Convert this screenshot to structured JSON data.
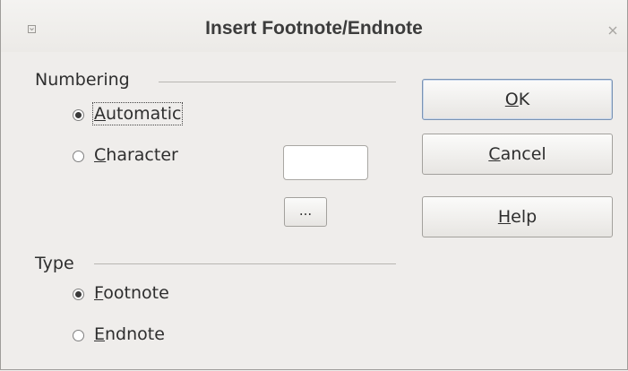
{
  "window": {
    "title": "Insert Footnote/Endnote"
  },
  "numbering": {
    "label": "Numbering",
    "automatic": {
      "accel": "A",
      "rest": "utomatic",
      "checked": true
    },
    "character": {
      "accel": "C",
      "rest": "haracter",
      "checked": false
    },
    "character_value": "",
    "browse_label": "..."
  },
  "type": {
    "label": "Type",
    "footnote": {
      "accel": "F",
      "rest": "ootnote",
      "checked": true
    },
    "endnote": {
      "accel": "E",
      "rest": "ndnote",
      "checked": false
    }
  },
  "buttons": {
    "ok": {
      "accel": "O",
      "rest": "K"
    },
    "cancel": {
      "accel": "C",
      "rest": "ancel"
    },
    "help": {
      "accel": "H",
      "rest": "elp"
    }
  },
  "icons": {
    "window_menu": "window-menu-icon",
    "close": "close-icon"
  }
}
